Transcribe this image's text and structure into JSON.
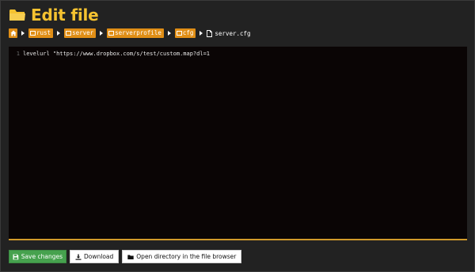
{
  "header": {
    "title": "Edit file",
    "icon": "folder-open-icon",
    "accent_color": "#f5c230"
  },
  "breadcrumb": {
    "home_icon": "home-icon",
    "items": [
      {
        "label": "rust"
      },
      {
        "label": "server"
      },
      {
        "label": "serverprofile"
      },
      {
        "label": "cfg"
      }
    ],
    "current_file": "server.cfg",
    "crumb_color": "#e08e16"
  },
  "editor": {
    "lines": [
      {
        "number": "1",
        "text": "levelurl \"https://www.dropbox.com/s/test/custom.map?dl=1"
      }
    ],
    "background": "#0a0505",
    "border_color": "#d19a2a"
  },
  "actions": {
    "save_label": "Save changes",
    "download_label": "Download",
    "open_dir_label": "Open directory in the file browser",
    "save_color": "#46a24e"
  }
}
